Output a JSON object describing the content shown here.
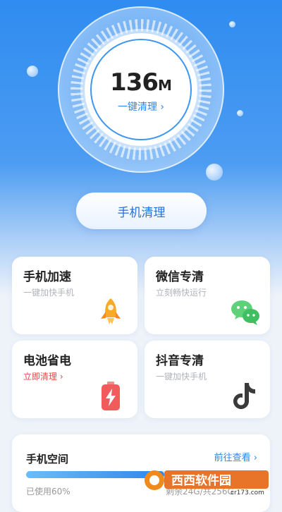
{
  "cleaner": {
    "size_value": "136",
    "size_unit": "M",
    "one_tap_label": "一键清理",
    "one_tap_arrow": "›"
  },
  "main_button": "手机清理",
  "cards": [
    {
      "title": "手机加速",
      "subtitle": "一键加快手机",
      "icon": "rocket-icon"
    },
    {
      "title": "微信专清",
      "subtitle": "立刻畅快运行",
      "icon": "wechat-icon"
    },
    {
      "title": "电池省电",
      "subtitle": "立即清理 ›",
      "icon": "battery-icon"
    },
    {
      "title": "抖音专清",
      "subtitle": "一键加快手机",
      "icon": "tiktok-icon"
    }
  ],
  "storage": {
    "title": "手机空间",
    "link": "前往查看 ›",
    "used_percent": 60,
    "used_label": "已使用60%",
    "remain_label": "剩余24G/共256G"
  },
  "watermark": {
    "brand": "西西软件园",
    "url": "cr173.com"
  },
  "colors": {
    "primary": "#2f86ea",
    "danger": "#e84a4a",
    "background_top": "#2f8cf0"
  }
}
